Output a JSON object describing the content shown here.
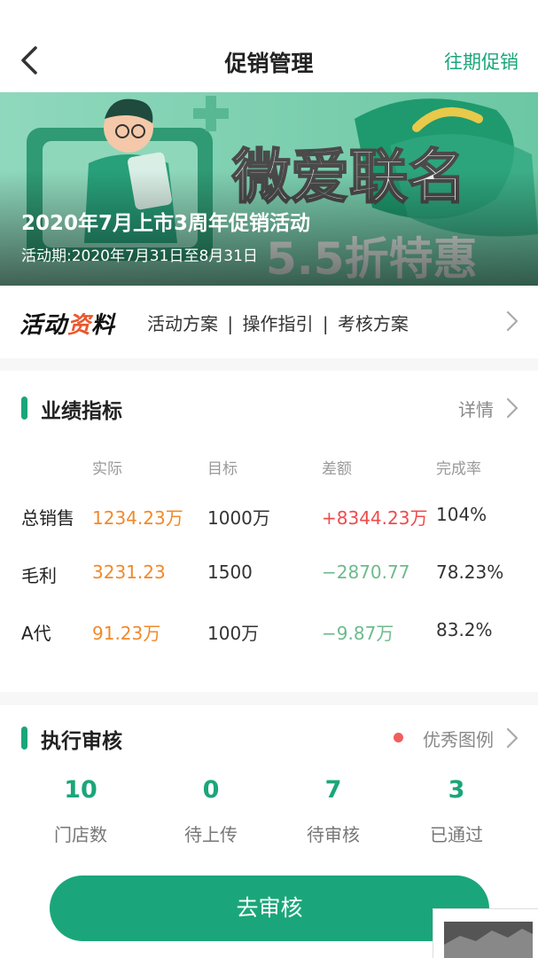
{
  "nav": {
    "title": "促销管理",
    "history_link": "往期促销",
    "back_icon": "chevron-left-icon"
  },
  "banner": {
    "title": "2020年7月上市3周年促销活动",
    "period": "活动期:2020年7月31日至8月31日",
    "art_text": "微爱联名",
    "art_subtext": "5.5折特惠"
  },
  "materials": {
    "logo_a": "活动",
    "logo_b": "资",
    "logo_c": "料",
    "links": [
      "活动方案",
      "操作指引",
      "考核方案"
    ],
    "separator": "|"
  },
  "performance": {
    "title": "业绩指标",
    "detail_link": "详情",
    "columns": [
      "实际",
      "目标",
      "差额",
      "完成率"
    ],
    "rows": [
      {
        "label": "总销售",
        "actual": "1234.23万",
        "target": "1000万",
        "diff": "+8344.23万",
        "rate": "104%"
      },
      {
        "label": "毛利",
        "actual": "3231.23",
        "target": "1500",
        "diff": "−2870.77",
        "rate": "78.23%"
      },
      {
        "label": "A代",
        "actual": "91.23万",
        "target": "100万",
        "diff": "−9.87万",
        "rate": "83.2%"
      }
    ]
  },
  "review": {
    "title": "执行审核",
    "legend_link": "优秀图例",
    "stats": [
      {
        "value": "10",
        "label": "门店数"
      },
      {
        "value": "0",
        "label": "待上传"
      },
      {
        "value": "7",
        "label": "待审核"
      },
      {
        "value": "3",
        "label": "已通过"
      }
    ],
    "cta_label": "去审核"
  },
  "colors": {
    "accent": "#1aa67a",
    "actual": "#f08a2b",
    "positive_diff": "#ef4b4b",
    "negative_diff": "#6dbb8c",
    "badge_dot": "#f25d5d"
  }
}
